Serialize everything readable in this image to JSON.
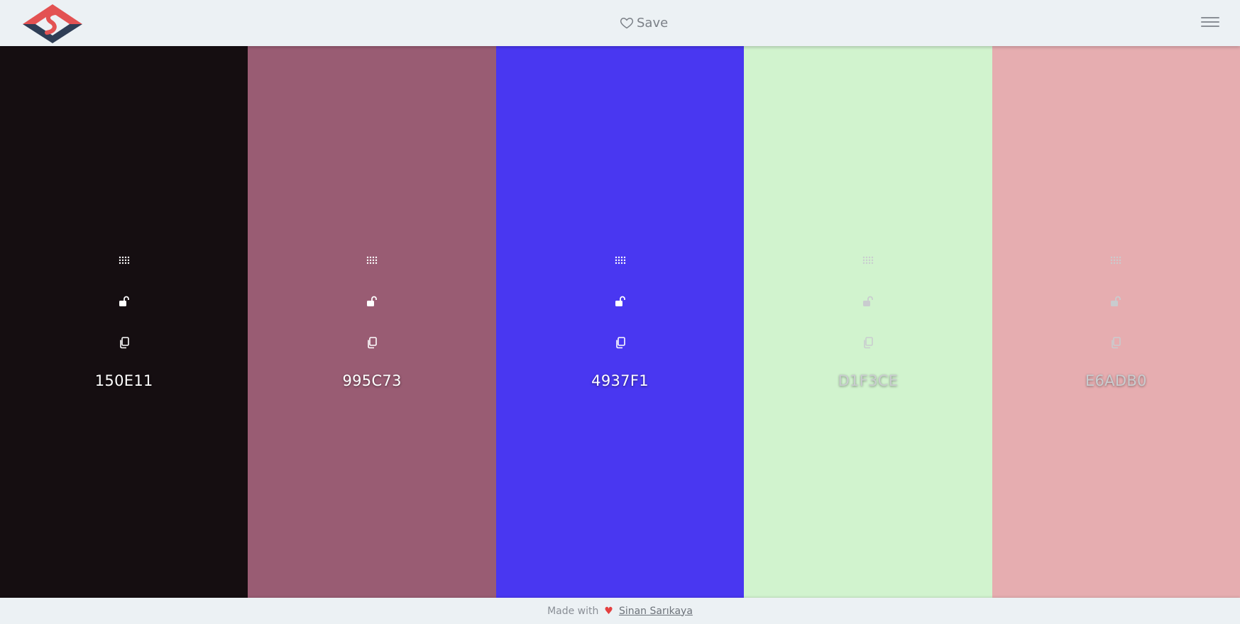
{
  "header": {
    "save_label": "Save",
    "logo_icon": "logo-diamond-s",
    "menu_icon": "hamburger-icon"
  },
  "palette": [
    {
      "hex": "150E11",
      "color": "#150E11",
      "tone": "dark"
    },
    {
      "hex": "995C73",
      "color": "#995C73",
      "tone": "dark"
    },
    {
      "hex": "4937F1",
      "color": "#4937F1",
      "tone": "dark"
    },
    {
      "hex": "D1F3CE",
      "color": "#D1F3CE",
      "tone": "light"
    },
    {
      "hex": "E6ADB0",
      "color": "#E6ADB0",
      "tone": "light"
    }
  ],
  "footer": {
    "made_with": "Made with",
    "author": "Sinan Sarıkaya",
    "heart_color": "#e44040"
  },
  "colors": {
    "background": "#ecf1f4",
    "logo_red": "#e35252",
    "logo_navy": "#2f3e56"
  }
}
